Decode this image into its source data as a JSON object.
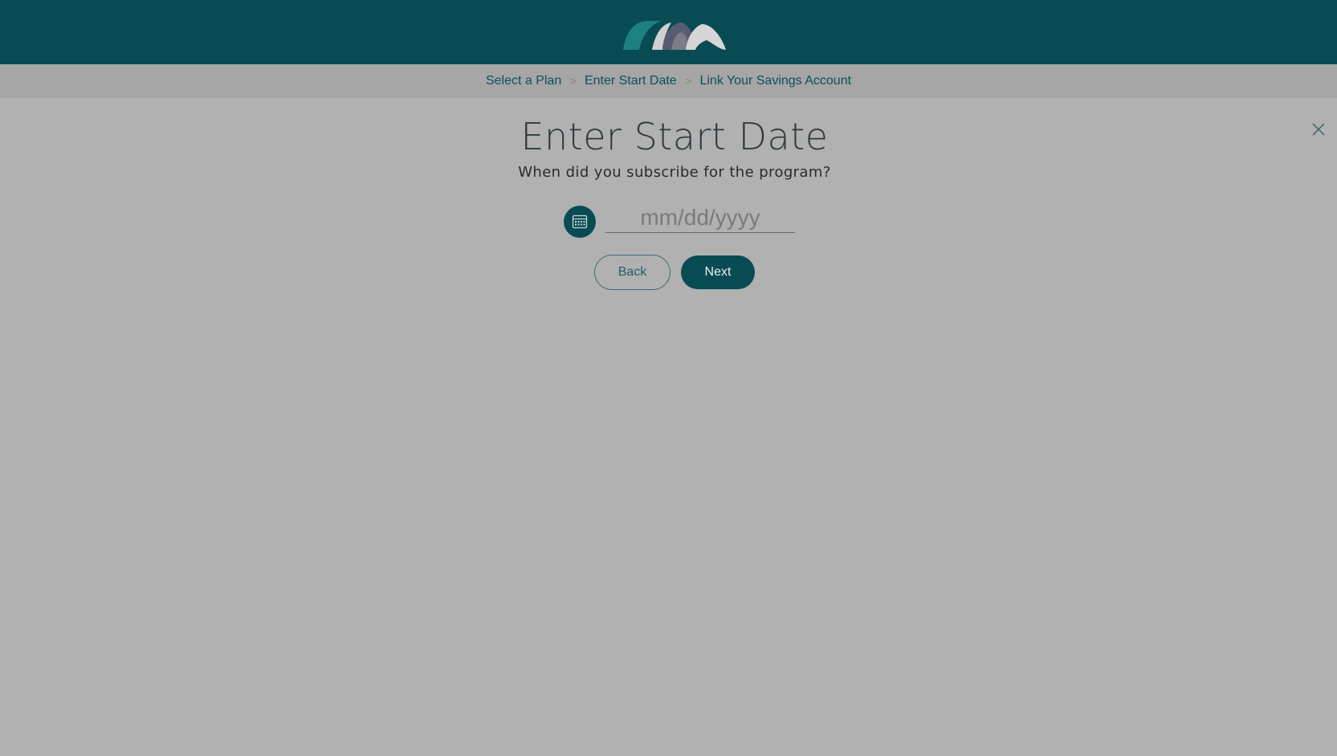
{
  "header": {
    "logo_icon": "brand-logo-arches",
    "colors": {
      "bar": "#094b53",
      "accent_teal": "#1c7f80",
      "accent_gray": "#d4d4d4",
      "accent_slate": "#4a4f63"
    }
  },
  "breadcrumb": {
    "items": [
      {
        "label": "Select a Plan"
      },
      {
        "label": "Enter Start Date"
      },
      {
        "label": "Link Your Savings Account"
      }
    ],
    "separator": ">"
  },
  "close": {
    "icon": "close-icon"
  },
  "main": {
    "title": "Enter Start Date",
    "subtitle": "When did you subscribe for the program?",
    "date_field": {
      "icon": "calendar-icon",
      "value": "",
      "placeholder": "mm/dd/yyyy"
    },
    "back_label": "Back",
    "next_label": "Next"
  }
}
